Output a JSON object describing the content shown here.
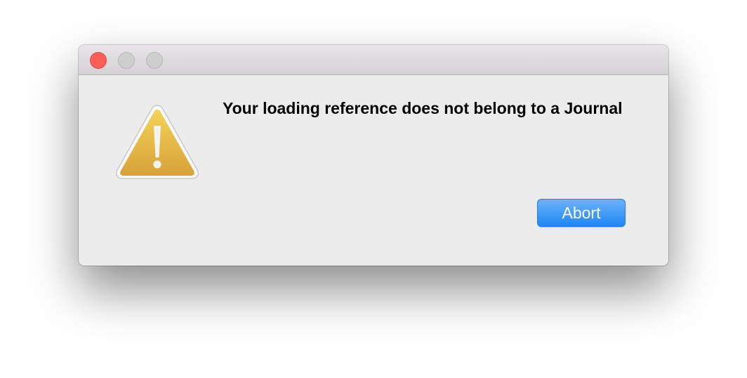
{
  "dialog": {
    "message": "Your loading reference does not belong to a Journal",
    "abort_label": "Abort",
    "icon": "warning-icon"
  },
  "window_controls": {
    "close": "close-icon",
    "minimize": "minimize-icon",
    "zoom": "zoom-icon"
  },
  "colors": {
    "close": "#fc5f57",
    "inactive_light": "#d0cfd0",
    "button_top": "#6cb3fa",
    "button_bottom": "#1f86f5",
    "warning_top": "#f3cf55",
    "warning_bottom": "#d9a63a",
    "window_bg": "#ececec"
  }
}
